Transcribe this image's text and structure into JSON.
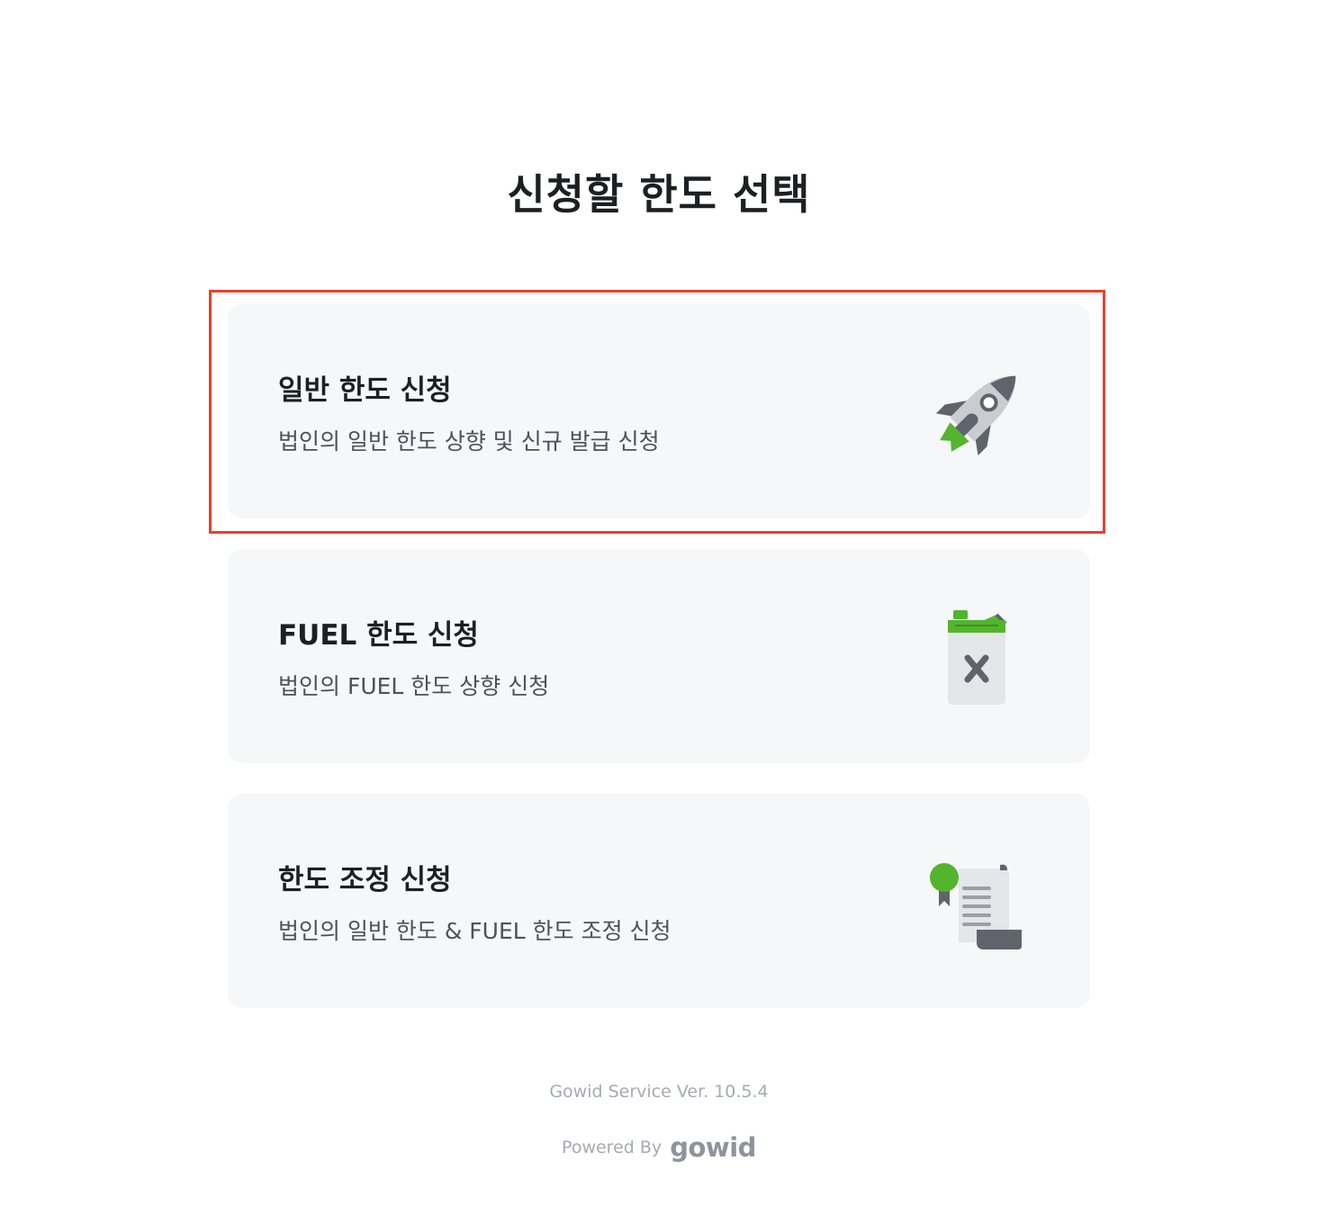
{
  "page": {
    "title": "신청할 한도 선택"
  },
  "options": [
    {
      "title": "일반 한도 신청",
      "description": "법인의 일반 한도 상향 및 신규 발급 신청",
      "icon": "rocket-icon",
      "selected": true
    },
    {
      "title": "FUEL 한도 신청",
      "description": "법인의 FUEL 한도 상향 신청",
      "icon": "fuel-can-icon",
      "selected": false
    },
    {
      "title": "한도 조정 신청",
      "description": "법인의 일반 한도 & FUEL 한도 조정 신청",
      "icon": "certificate-scroll-icon",
      "selected": false
    }
  ],
  "footer": {
    "version": "Gowid Service Ver. 10.5.4",
    "powered_by": "Powered By",
    "brand": "gowid"
  },
  "colors": {
    "accent_green": "#52b52d",
    "icon_gray": "#5f646c",
    "card_bg": "#f6f7f9",
    "highlight": "#e8412c"
  }
}
